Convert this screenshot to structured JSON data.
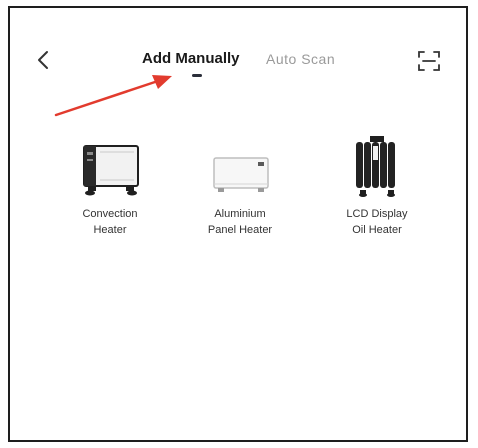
{
  "header": {
    "tabs": [
      {
        "label": "Add Manually",
        "active": true
      },
      {
        "label": "Auto Scan",
        "active": false
      }
    ],
    "icons": {
      "back": "chevron-left-icon",
      "scan": "scan-frame-icon"
    }
  },
  "annotation": {
    "arrow_color": "#e23b2e",
    "points_to": "Add Manually"
  },
  "devices": [
    {
      "line1": "Convection",
      "line2": "Heater"
    },
    {
      "line1": "Aluminium",
      "line2": "Panel Heater"
    },
    {
      "line1": "LCD Display",
      "line2": "Oil Heater"
    }
  ]
}
